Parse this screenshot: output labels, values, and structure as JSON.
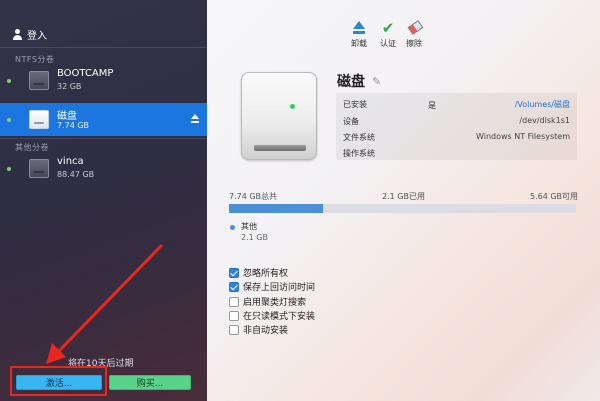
{
  "sidebar": {
    "login_label": "登入",
    "sections": [
      {
        "title": "NTFS分卷"
      },
      {
        "title": "其他分卷"
      }
    ],
    "volumes": [
      {
        "name": "BOOTCAMP",
        "size": "32 GB",
        "selected": false
      },
      {
        "name": "磁盘",
        "size": "7.74 GB",
        "selected": true
      },
      {
        "name": "vinca",
        "size": "88.47 GB",
        "selected": false
      }
    ],
    "expiry_text": "将在10天后过期",
    "activate_label": "激活...",
    "buy_label": "购买..."
  },
  "toolbar": {
    "unmount_label": "卸载",
    "verify_label": "认证",
    "erase_label": "擦除"
  },
  "disk": {
    "title": "磁盘",
    "info": {
      "mounted_label": "已安装",
      "mounted_value": "是",
      "mounted_path": "/Volumes/磁盘",
      "device_label": "设备",
      "device_value": "/dev/disk1s1",
      "fs_label": "文件系统",
      "fs_value": "Windows NT Filesystem",
      "os_label": "操作系统",
      "os_value": ""
    },
    "usage": {
      "total_label": "7.74 GB总共",
      "used_label": "2.1 GB已用",
      "free_label": "5.64 GB可用",
      "used_fraction": 0.271,
      "legend_name": "其他",
      "legend_size": "2.1 GB"
    }
  },
  "options": [
    {
      "label": "忽略所有权",
      "checked": true
    },
    {
      "label": "保存上回访问时间",
      "checked": true
    },
    {
      "label": "启用聚类灯搜索",
      "checked": false
    },
    {
      "label": "在只读模式下安装",
      "checked": false
    },
    {
      "label": "非自动安装",
      "checked": false
    }
  ],
  "colors": {
    "accent": "#1b76e0",
    "activate": "#38b6f2",
    "buy": "#59d389",
    "annotation": "#e8281e"
  }
}
